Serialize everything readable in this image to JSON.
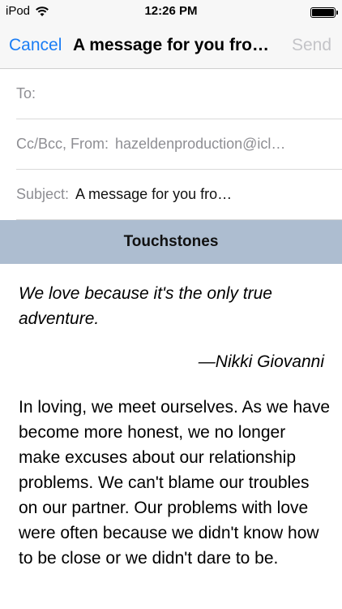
{
  "status_bar": {
    "carrier": "iPod",
    "time": "12:26 PM"
  },
  "nav": {
    "cancel_label": "Cancel",
    "title": "A message for you fro…",
    "send_label": "Send"
  },
  "compose": {
    "to_label": "To:",
    "cc_label": "Cc/Bcc, From:",
    "from_value": "hazeldenproduction@icl…",
    "subject_label": "Subject:",
    "subject_value": "A message for you fro…"
  },
  "content": {
    "header": "Touchstones",
    "quote": "We love because it's the only true adventure.",
    "attribution": "—Nikki Giovanni",
    "body": "In loving, we meet ourselves. As we have become more honest, we no longer make excuses about our relationship problems. We can't blame our troubles on our partner. Our problems with love were often because we didn't know how to be close or we didn't dare to be."
  },
  "colors": {
    "accent": "#1a7df5",
    "send_disabled": "#c4c4c8",
    "header_band": "#adbdd0"
  },
  "icons": {
    "wifi": "wifi-icon",
    "battery": "battery-icon"
  }
}
